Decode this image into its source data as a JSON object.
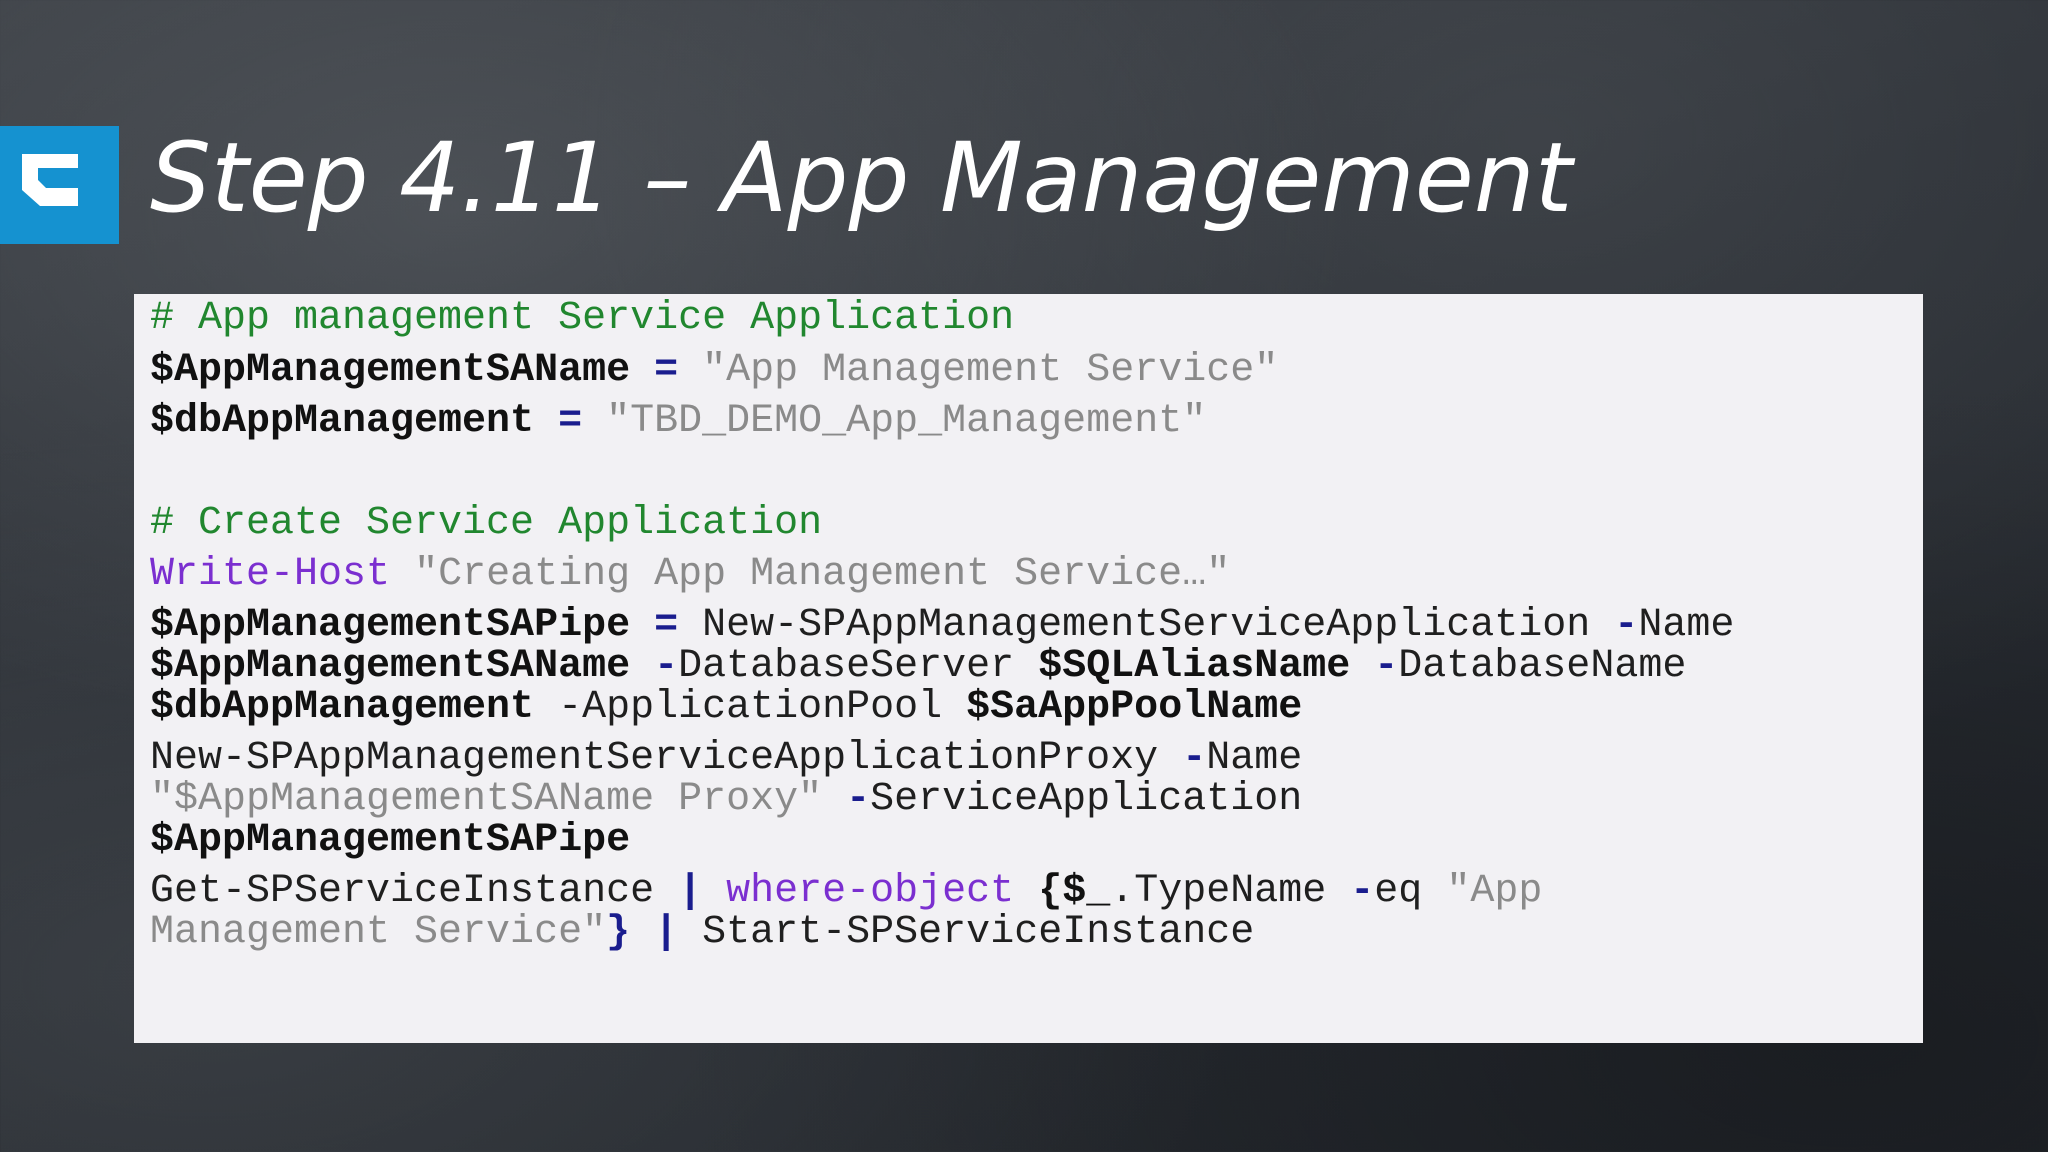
{
  "slide": {
    "title": "Step 4.11 – App Management",
    "logo_icon": "brand-logo-icon",
    "colors": {
      "logo": "#1592d0",
      "comment": "#21872f",
      "keyword": "#7b2fd0",
      "operator": "#1a1d8e",
      "string": "#8a8a8a",
      "panel": "#f2f1f4"
    }
  },
  "code": {
    "l1": {
      "comment": "# App management Service Application"
    },
    "l2": {
      "var": "$AppManagementSAName",
      "op": "=",
      "str": "\"App Management Service\""
    },
    "l3": {
      "var": "$dbAppManagement",
      "op": "=",
      "str": "\"TBD_DEMO_App_Management\""
    },
    "l4": {
      "comment": "# Create Service Application"
    },
    "l5": {
      "kw": "Write-Host",
      "str": "\"Creating App Management Service…\""
    },
    "l6": {
      "var": "$AppManagementSAPipe",
      "op": "=",
      "cmd": "New-SPAppManagementServiceApplication",
      "dash": "-",
      "param": "Name"
    },
    "l7": {
      "var": "$AppManagementSAName",
      "dash": "-",
      "param": "DatabaseServer",
      "var2": "$SQLAliasName",
      "dash2": "-",
      "param2": "DatabaseName"
    },
    "l8": {
      "var": "$dbAppManagement",
      "param": "-ApplicationPool",
      "var2": "$SaAppPoolName"
    },
    "l9": {
      "cmd": "New-SPAppManagementServiceApplicationProxy",
      "dash": "-",
      "param": "Name"
    },
    "l10": {
      "str": "\"$AppManagementSAName Proxy\"",
      "dash": "-",
      "param": "ServiceApplication"
    },
    "l11": {
      "var": "$AppManagementSAPipe"
    },
    "l12": {
      "cmd": "Get-SPServiceInstance",
      "pipe": "|",
      "kw": "where-object",
      "brace": "{$_",
      "prop": ".TypeName",
      "dash": "-",
      "param": "eq",
      "str": "\"App"
    },
    "l13": {
      "str": "Management Service\"",
      "brace": "}",
      "pipe": "|",
      "cmd": "Start-SPServiceInstance"
    }
  }
}
